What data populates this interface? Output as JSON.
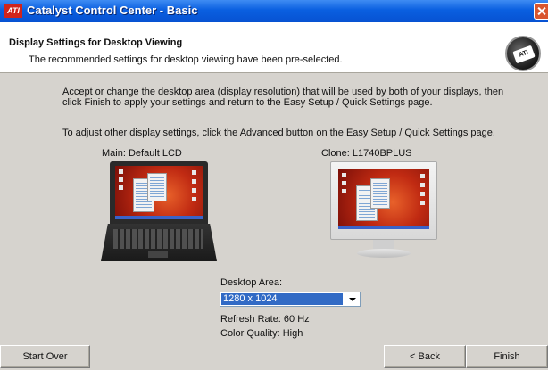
{
  "window": {
    "title": "Catalyst Control Center - Basic",
    "logo_text": "ATI"
  },
  "header": {
    "title": "Display Settings for Desktop Viewing",
    "subtitle": "The recommended settings for desktop viewing have been pre-selected.",
    "badge_text": "ATI"
  },
  "body": {
    "paragraph1_line1": "Accept or change the desktop area (display resolution) that will be used by both of your displays, then",
    "paragraph1_line2": "click Finish to apply your settings and return to the Easy Setup / Quick Settings page.",
    "paragraph2": "To adjust other display settings, click the Advanced button on the Easy Setup / Quick Settings page."
  },
  "displays": {
    "main_label": "Main: Default LCD",
    "clone_label": "Clone: L1740BPLUS"
  },
  "settings": {
    "desktop_area_label": "Desktop Area:",
    "desktop_area_value": "1280 x 1024",
    "refresh_rate": "Refresh Rate: 60 Hz",
    "color_quality": "Color Quality: High"
  },
  "buttons": {
    "start_over": "Start Over",
    "back": "< Back",
    "finish": "Finish"
  },
  "colors": {
    "titlebar": "#0a5fe0",
    "selection": "#316ac5",
    "close": "#d9562f"
  }
}
